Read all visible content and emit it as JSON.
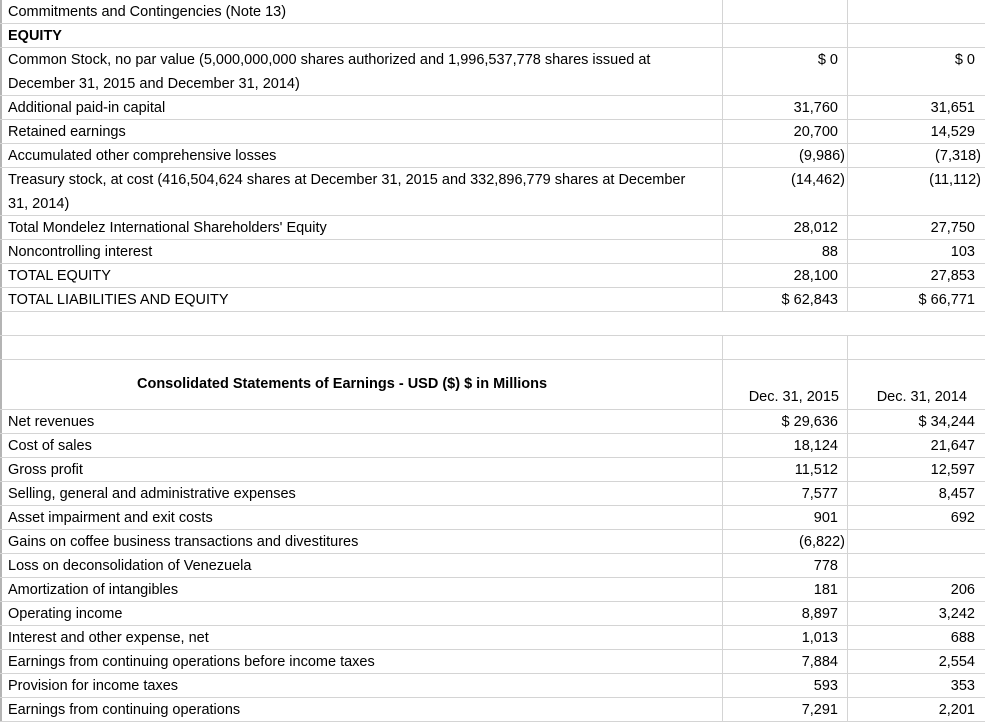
{
  "balance_sheet_fragment": {
    "rows": [
      {
        "label": "Commitments and Contingencies (Note 13)",
        "v2015": "",
        "v2014": "",
        "bold": false
      },
      {
        "label": "EQUITY",
        "v2015": "",
        "v2014": "",
        "bold": true
      },
      {
        "label": "Common Stock, no par value (5,000,000,000 shares authorized and 1,996,537,778 shares issued at December 31, 2015 and December 31, 2014)",
        "v2015": "$ 0",
        "v2014": "$ 0",
        "bold": false
      },
      {
        "label": "Additional paid-in capital",
        "v2015": "31,760",
        "v2014": "31,651",
        "bold": false
      },
      {
        "label": "Retained earnings",
        "v2015": "20,700",
        "v2014": "14,529",
        "bold": false
      },
      {
        "label": "Accumulated other comprehensive losses",
        "v2015": "(9,986)",
        "v2014": "(7,318)",
        "bold": false
      },
      {
        "label": "Treasury stock, at cost (416,504,624 shares at December 31, 2015 and 332,896,779 shares at December 31, 2014)",
        "v2015": "(14,462)",
        "v2014": "(11,112)",
        "bold": false
      },
      {
        "label": "Total Mondelez International Shareholders' Equity",
        "v2015": "28,012",
        "v2014": "27,750",
        "bold": false
      },
      {
        "label": "Noncontrolling interest",
        "v2015": "88",
        "v2014": "103",
        "bold": false
      },
      {
        "label": "TOTAL EQUITY",
        "v2015": "28,100",
        "v2014": "27,853",
        "bold": false
      },
      {
        "label": "TOTAL LIABILITIES AND EQUITY",
        "v2015": "$ 62,843",
        "v2014": "$ 66,771",
        "bold": false
      }
    ]
  },
  "earnings_statement": {
    "title": "Consolidated Statements of Earnings - USD ($) $ in Millions",
    "col_2015": "Dec. 31, 2015",
    "col_2014": "Dec. 31, 2014",
    "rows": [
      {
        "label": "Net revenues",
        "v2015": "$ 29,636",
        "v2014": "$ 34,244"
      },
      {
        "label": "Cost of sales",
        "v2015": "18,124",
        "v2014": "21,647"
      },
      {
        "label": "Gross profit",
        "v2015": "11,512",
        "v2014": "12,597"
      },
      {
        "label": "Selling, general and administrative expenses",
        "v2015": "7,577",
        "v2014": "8,457"
      },
      {
        "label": "Asset impairment and exit costs",
        "v2015": "901",
        "v2014": "692"
      },
      {
        "label": "Gains on coffee business transactions and divestitures",
        "v2015": "(6,822)",
        "v2014": ""
      },
      {
        "label": "Loss on deconsolidation of Venezuela",
        "v2015": "778",
        "v2014": ""
      },
      {
        "label": "Amortization of intangibles",
        "v2015": "181",
        "v2014": "206"
      },
      {
        "label": "Operating income",
        "v2015": "8,897",
        "v2014": "3,242"
      },
      {
        "label": "Interest and other expense, net",
        "v2015": "1,013",
        "v2014": "688"
      },
      {
        "label": "Earnings from continuing operations before income taxes",
        "v2015": "7,884",
        "v2014": "2,554"
      },
      {
        "label": "Provision for income taxes",
        "v2015": "593",
        "v2014": "353"
      },
      {
        "label": "Earnings from continuing operations",
        "v2015": "7,291",
        "v2014": "2,201"
      }
    ]
  }
}
